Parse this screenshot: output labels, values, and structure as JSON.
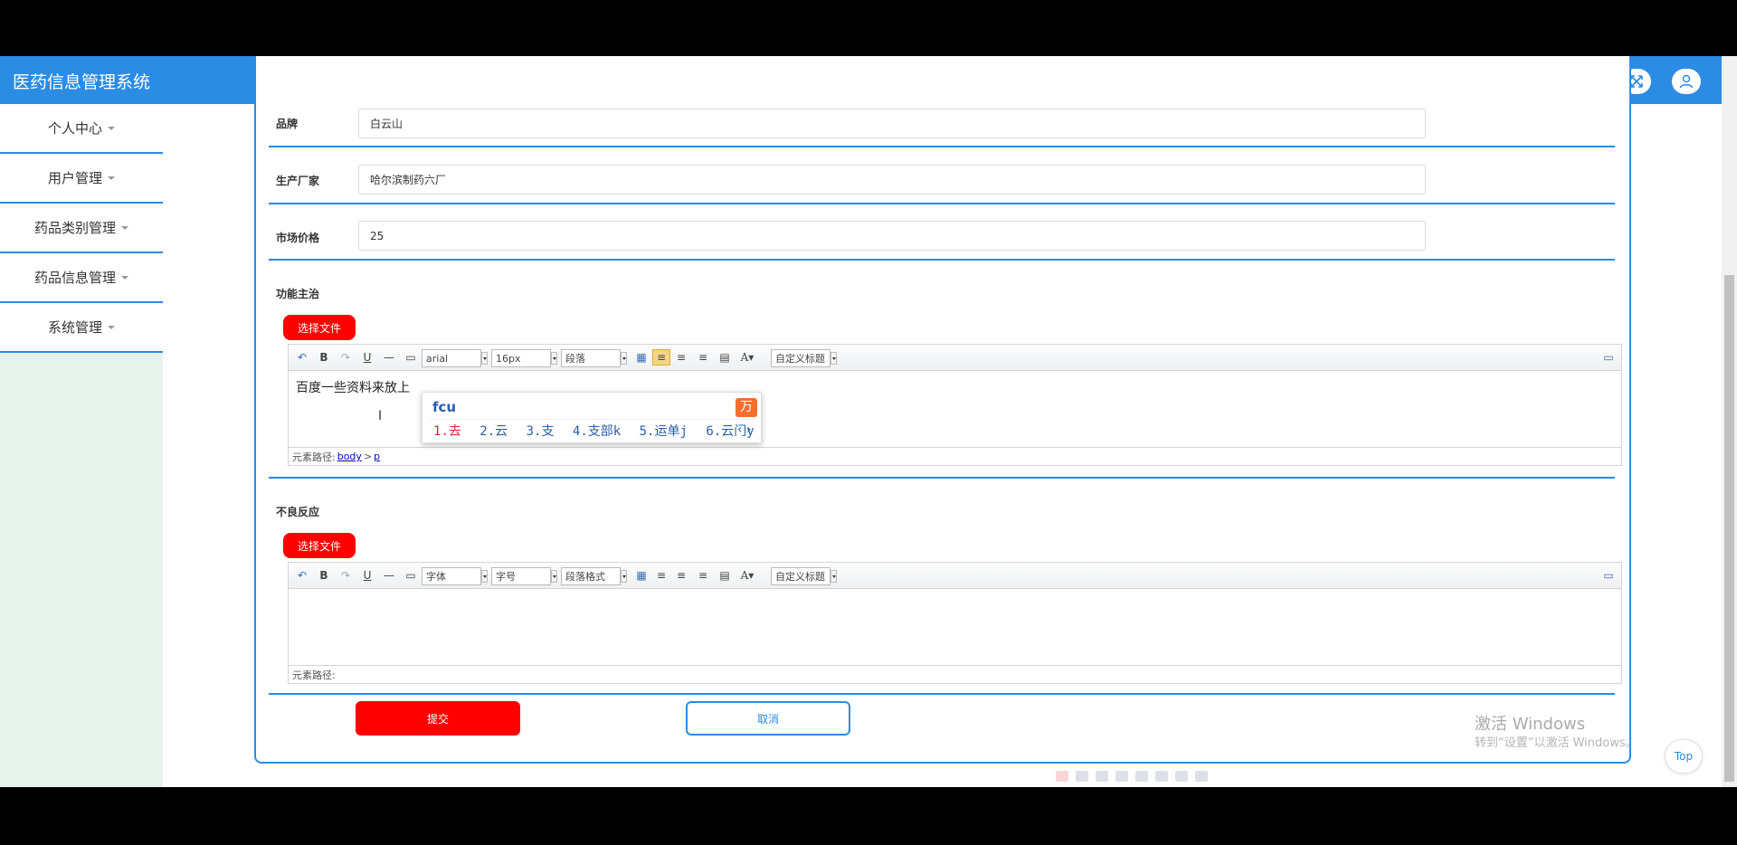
{
  "header": {
    "title": "医药信息管理系统",
    "fullscreen_icon": "expand-arrows-icon",
    "user_icon": "user-icon"
  },
  "sidebar": {
    "items": [
      {
        "label": "个人中心"
      },
      {
        "label": "用户管理"
      },
      {
        "label": "药品类别管理"
      },
      {
        "label": "药品信息管理"
      },
      {
        "label": "系统管理"
      }
    ]
  },
  "form": {
    "brand": {
      "label": "品牌",
      "value": "白云山"
    },
    "manufacturer": {
      "label": "生产厂家",
      "value": "哈尔滨制药六厂"
    },
    "price": {
      "label": "市场价格",
      "value": "25"
    },
    "function_section": {
      "label": "功能主治",
      "file_button": "选择文件",
      "font": "arial",
      "size": "16px",
      "paragraph": "段落",
      "custom_title": "自定义标题",
      "content": "百度一些资料来放上",
      "path_label": "元素路径:",
      "path_body": "body",
      "path_sep": ">",
      "path_p": "p"
    },
    "adverse_section": {
      "label": "不良反应",
      "file_button": "选择文件",
      "font": "字体",
      "size": "字号",
      "paragraph": "段落格式",
      "custom_title": "自定义标题",
      "path_label": "元素路径:"
    },
    "submit": "提交",
    "cancel": "取消"
  },
  "ime": {
    "code": "fcu",
    "candidates": [
      "1.去",
      "2.云",
      "3.支",
      "4.支部k",
      "5.运单j",
      "6.云门y"
    ],
    "nav": "‹ ›"
  },
  "watermark": {
    "line1": "激活 Windows",
    "line2": "转到“设置”以激活 Windows。"
  },
  "top_button": "Top",
  "colors": {
    "primary": "#2c8be3",
    "danger": "#ff0000",
    "sidebar_bg": "#e7f2ec"
  }
}
